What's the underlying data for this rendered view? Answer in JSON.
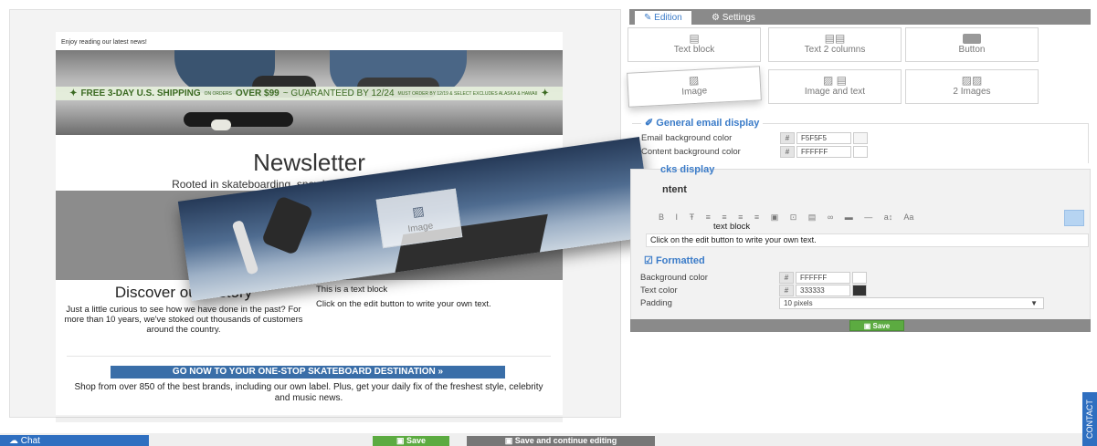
{
  "email": {
    "preheader": "Enjoy reading our latest news!",
    "shipping": {
      "main": "FREE 3-DAY U.S. SHIPPING",
      "on_orders": "ON ORDERS",
      "amount": "OVER $99",
      "guaranteed": "~ GUARANTEED BY 12/24",
      "fine": "MUST ORDER BY 12/19 & SELECT EXCLUDES ALASKA & HAWAII"
    },
    "title": "Newsletter",
    "subtitle": "Rooted in skateboarding, snowboarding, and surfing and",
    "history_title": "Discover our history",
    "history_body": "Just a little curious to see how we have done in the past? For more than 10 years, we've stoked out thousands of customers around the country.",
    "text_block_title": "This is a text block",
    "text_block_body": "Click on the edit button to write your own text.",
    "cta": "GO NOW TO YOUR ONE-STOP SKATEBOARD DESTINATION »",
    "shop_text": "Shop from over 850 of the best brands, including our own label. Plus, get your daily fix of the freshest style, celebrity and music news."
  },
  "dragging": {
    "tile_label": "Image"
  },
  "tabs": {
    "edition": "Edition",
    "settings": "Settings"
  },
  "blocks": {
    "text_block": "Text block",
    "text_2_columns": "Text 2 columns",
    "button": "Button",
    "image": "Image",
    "image_and_text": "Image and text",
    "two_images": "2 Images"
  },
  "general": {
    "legend": "General email display",
    "email_bg_label": "Email background color",
    "email_bg_value": "F5F5F5",
    "content_bg_label": "Content background color",
    "content_bg_value": "FFFFFF",
    "hash": "#"
  },
  "blocks_display": {
    "legend": "cks display",
    "content_legend": "ntent",
    "toolbar": [
      "B",
      "I",
      "Ŧ",
      "≡",
      "≡",
      "≡",
      "≡",
      "▣",
      "⊡",
      "▤",
      "∞",
      "▬",
      "—",
      "a↕",
      "Aa"
    ],
    "text_block_label": "text block",
    "tooltip": "Click on the edit button to write your own text.",
    "formatted_legend": "Formatted",
    "bg_label": "Background color",
    "bg_value": "FFFFFF",
    "text_color_label": "Text color",
    "text_color_value": "333333",
    "padding_label": "Padding",
    "padding_value": "10 pixels",
    "save": "Save"
  },
  "bottom": {
    "chat": "Chat",
    "save": "Save",
    "save_continue": "Save and continue editing",
    "contact": "CONTACT"
  },
  "colors": {
    "accent_blue": "#3a7bc8",
    "save_green": "#5cab41",
    "text_color_swatch": "#333333"
  }
}
